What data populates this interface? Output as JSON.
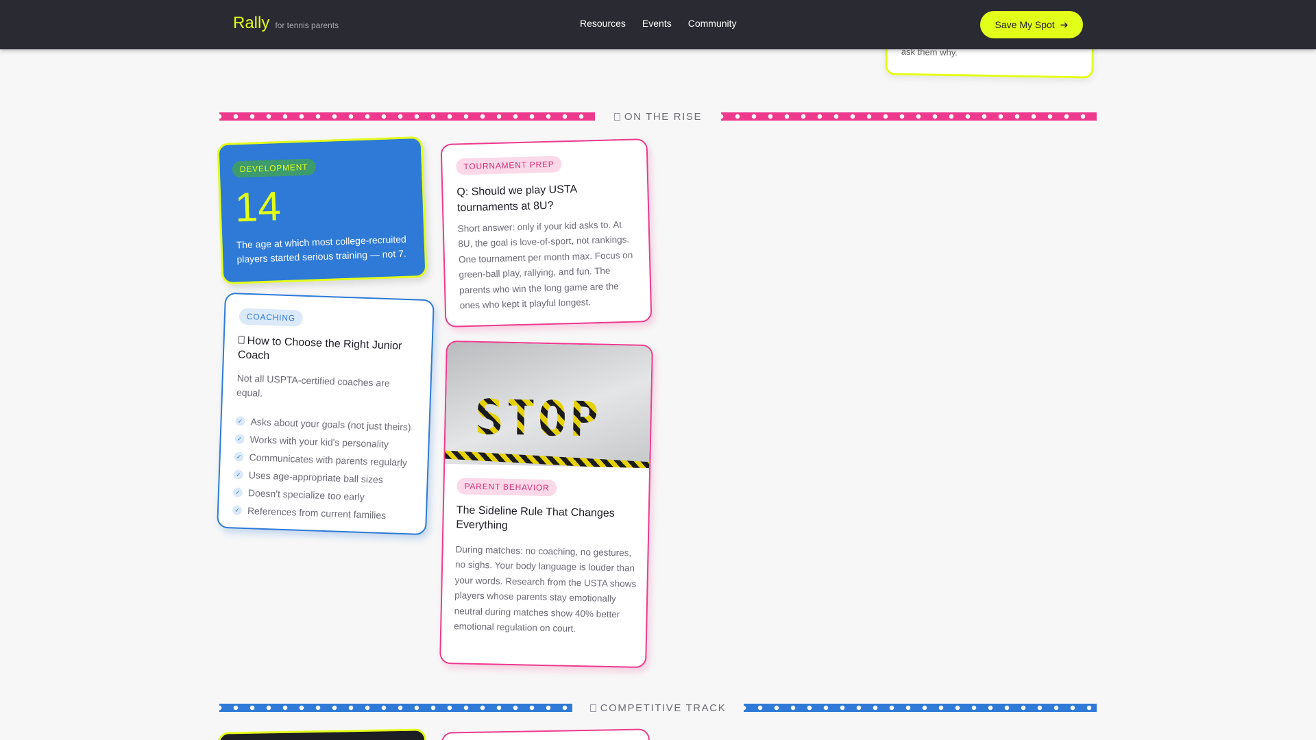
{
  "nav": {
    "brand": "Rally",
    "tagline": "for tennis parents",
    "links": [
      "Resources",
      "Events",
      "Community"
    ],
    "cta_label": "Save My Spot",
    "cta_icon": "arrow-right-icon"
  },
  "previous_card": {
    "text_tail": "ask them why."
  },
  "sections": [
    {
      "label": "ON THE RISE",
      "icon": "sparkle-icon",
      "stripe_color": "#ee3a8c"
    },
    {
      "label": "COMPETITIVE TRACK",
      "icon": "trophy-icon",
      "stripe_color": "#2e7ad6"
    }
  ],
  "cards": {
    "development": {
      "badge": "DEVELOPMENT",
      "stat": "14",
      "description": "The age at which most college-recruited players started serious training — not 7."
    },
    "coaching": {
      "badge": "COACHING",
      "title": "How to Choose the Right Junior Coach",
      "title_icon": "clipboard-icon",
      "subtitle": "Not all USPTA-certified coaches are equal.",
      "checklist": [
        "Asks about your goals (not just theirs)",
        "Works with your kid's personality",
        "Communicates with parents regularly",
        "Uses age-appropriate ball sizes",
        "Doesn't specialize too early",
        "References from current families"
      ]
    },
    "tournament": {
      "badge": "TOURNAMENT PREP",
      "title": "Q: Should we play USTA tournaments at 8U?",
      "body": "Short answer: only if your kid asks to. At 8U, the goal is love-of-sport, not rankings. One tournament per month max. Focus on green-ball play, rallying, and fun. The parents who win the long game are the ones who kept it playful longest."
    },
    "parent_behavior": {
      "badge": "PARENT BEHAVIOR",
      "image_text": "STOP",
      "title": "The Sideline Rule That Changes Everything",
      "body": "During matches: no coaching, no gestures, no sighs. Your body language is louder than your words. Research from the USTA shows players whose parents stay emotionally neutral during matches show 40% better emotional regulation on court."
    }
  },
  "colors": {
    "accent": "#e2ff1a",
    "pink": "#ee3a8c",
    "blue": "#2e7ad6",
    "nav_bg": "#2a2a33"
  }
}
